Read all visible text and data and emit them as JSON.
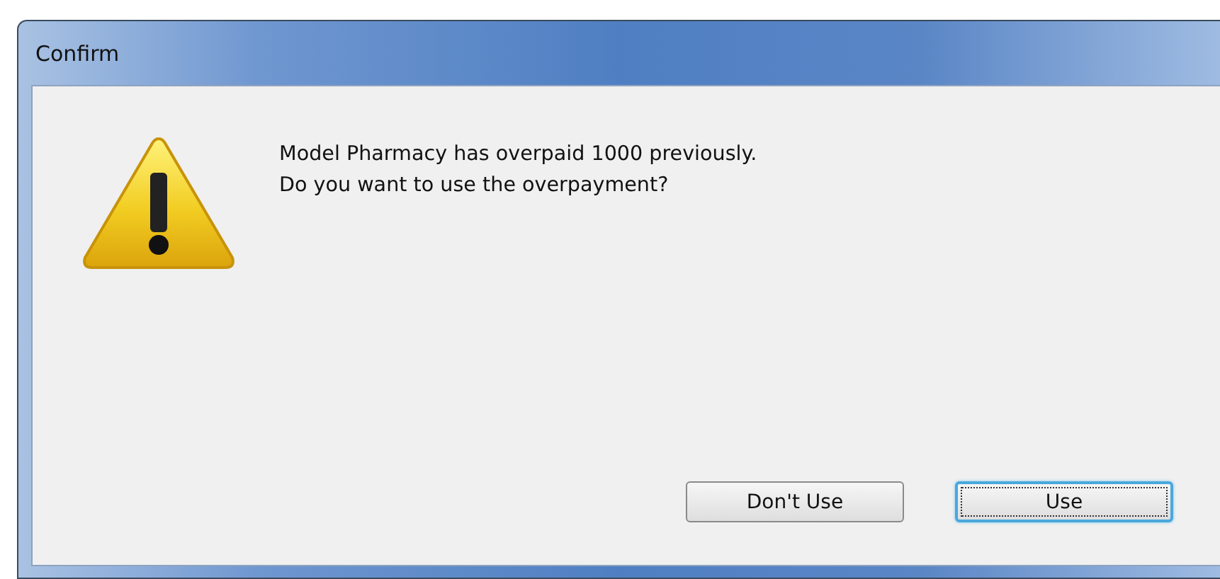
{
  "window": {
    "title": "Confirm"
  },
  "message": {
    "lines": [
      "Model Pharmacy has overpaid 1000 previously.",
      "Do you want to use the overpayment?"
    ]
  },
  "buttons": [
    {
      "label": "Don't Use",
      "focused": false
    },
    {
      "label": "Use",
      "focused": true
    }
  ]
}
